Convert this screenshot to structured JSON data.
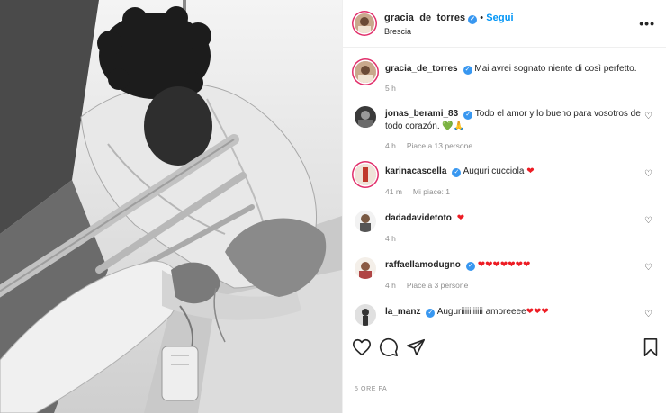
{
  "post": {
    "username": "gracia_de_torres",
    "follow_label": "Segui",
    "location": "Brescia",
    "timestamp": "5 ORE FA"
  },
  "comments": [
    {
      "username": "gracia_de_torres",
      "text": "Mai avrei sognato niente di così perfetto.",
      "time": "5 h",
      "likes": "",
      "verified": true
    },
    {
      "username": "jonas_berami_83",
      "text": "Todo el amor y lo bueno para vosotros de todo corazón.",
      "emoji": "💚🙏",
      "time": "4 h",
      "likes": "Piace a 13 persone",
      "verified": true
    },
    {
      "username": "karinacascella",
      "text": "Auguri cucciola",
      "emoji": "❤",
      "time": "41 m",
      "likes": "Mi piace: 1",
      "verified": true
    },
    {
      "username": "dadadavidetoto",
      "text": "",
      "emoji": "❤",
      "time": "4 h",
      "likes": "",
      "verified": false
    },
    {
      "username": "raffaellamodugno",
      "text": "",
      "emoji": "❤❤❤❤❤❤❤",
      "time": "4 h",
      "likes": "Piace a 3 persone",
      "verified": true
    },
    {
      "username": "la_manz",
      "text": "Auguriiiiiiiiiii amoreeee",
      "emoji": "❤❤❤",
      "time": "",
      "likes": "",
      "verified": true
    }
  ],
  "icons": {
    "like": "heart-outline-icon",
    "comment": "comment-icon",
    "share": "paper-plane-icon",
    "save": "bookmark-icon",
    "more": "more-options-icon",
    "verified": "verified-badge-icon"
  },
  "colors": {
    "accent": "#0095f6",
    "verified": "#3897f0",
    "heart": "#ed1c24",
    "muted": "#8e8e8e"
  },
  "symbols": {
    "more": "•••",
    "check": "✓",
    "dot": "•",
    "like_small": "♡"
  }
}
